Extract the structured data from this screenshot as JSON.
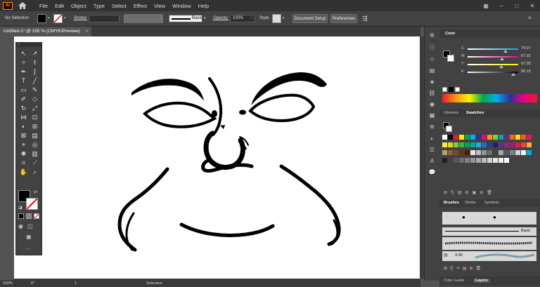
{
  "app": {
    "logo": "Ai"
  },
  "menu": [
    "File",
    "Edit",
    "Object",
    "Type",
    "Select",
    "Effect",
    "View",
    "Window",
    "Help"
  ],
  "control": {
    "selection_label": "No Selection",
    "stroke_label": "Stroke:",
    "brush": "Basic",
    "opacity_label": "Opacity:",
    "opacity_value": "100%",
    "style_label": "Style:",
    "document_setup": "Document Setup",
    "preferences": "Preferences"
  },
  "document": {
    "tab_title": "Untitled-1* @ 150 % (CMYK/Preview)",
    "close": "×"
  },
  "status": {
    "zoom": "150%",
    "rotation": "0°",
    "artboard": "1",
    "tool": "Selection"
  },
  "panels": {
    "color": {
      "tab": "Color",
      "sliders": [
        {
          "label": "C",
          "value": "74.97",
          "fraction": 0.75
        },
        {
          "label": "M",
          "value": "67.92",
          "fraction": 0.68
        },
        {
          "label": "Y",
          "value": "67.05",
          "fraction": 0.67
        },
        {
          "label": "K",
          "value": "90.15",
          "fraction": 0.9
        }
      ]
    },
    "swatches_tabs": [
      "Libraries",
      "Swatches"
    ],
    "brushes_tabs": [
      "Brushes",
      "Stroke",
      "Symbols"
    ],
    "brushes": {
      "basic_label": "Basic",
      "size_value": "3.00"
    },
    "bottom_tabs": [
      "Color Guide",
      "Layers"
    ]
  },
  "icons": {
    "home": "home-icon",
    "close": "close-icon"
  }
}
